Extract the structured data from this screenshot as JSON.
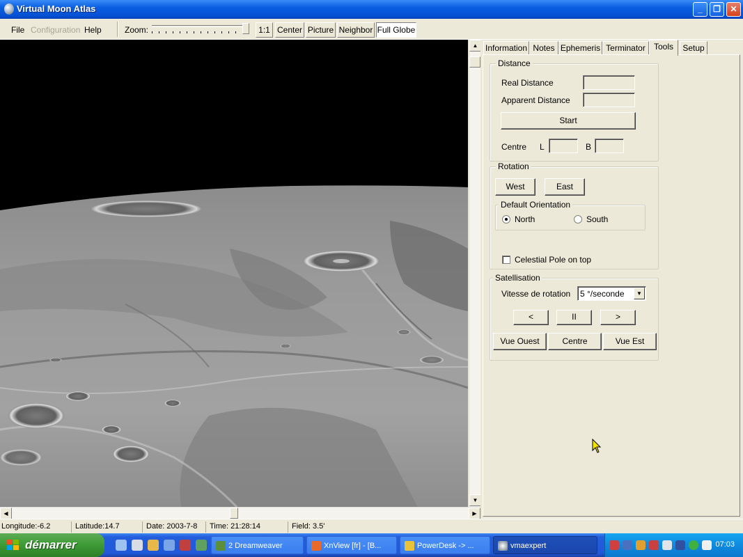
{
  "window": {
    "title": "Virtual Moon Atlas",
    "controls": [
      "_",
      "❐",
      "✕"
    ]
  },
  "menu": {
    "file": "File",
    "configuration": "Configuration",
    "help": "Help"
  },
  "toolbar": {
    "zoom_label": "Zoom:",
    "one_to_one": "1:1",
    "center": "Center",
    "picture": "Picture",
    "neighbor": "Neighbor",
    "full_globe": "Full Globe"
  },
  "tabs": [
    "Information",
    "Notes",
    "Ephemeris",
    "Terminator",
    "Tools",
    "Setup"
  ],
  "active_tab": "Tools",
  "distance": {
    "title": "Distance",
    "real_label": "Real Distance",
    "apparent_label": "Apparent Distance",
    "real_value": "",
    "apparent_value": "",
    "start_button": "Start",
    "centre_label": "Centre",
    "l_label": "L",
    "b_label": "B"
  },
  "rotation": {
    "title": "Rotation",
    "west_button": "West",
    "east_button": "East",
    "orientation_title": "Default Orientation",
    "north_label": "North",
    "south_label": "South",
    "selected": "North",
    "celestial_pole_label": "Celestial Pole on top",
    "celestial_pole_checked": false
  },
  "satellisation": {
    "title": "Satellisation",
    "speed_label": "Vitesse de rotation",
    "speed_value": "5 °/seconde",
    "prev_button": "<",
    "pause_button": "II",
    "next_button": ">",
    "west_view_button": "Vue Ouest",
    "centre_button": "Centre",
    "east_view_button": "Vue Est"
  },
  "status": {
    "longitude": "Longitude:-6.2",
    "latitude": "Latitude:14.7",
    "date": "Date: 2003-7-8",
    "time": "Time: 21:28:14",
    "field": "Field: 3.5'"
  },
  "taskbar": {
    "start_label": "démarrer",
    "tasks": [
      "2 Dreamweaver",
      "XnView [fr] - [B...",
      "PowerDesk -> ...",
      "vmaexpert"
    ],
    "clock": "07:03"
  },
  "colors": {
    "titlebar": "#0a5ee0",
    "taskbar": "#245edb",
    "start": "#3c9a34",
    "tray": "#0e8ae0",
    "panel": "#ece9d8"
  }
}
